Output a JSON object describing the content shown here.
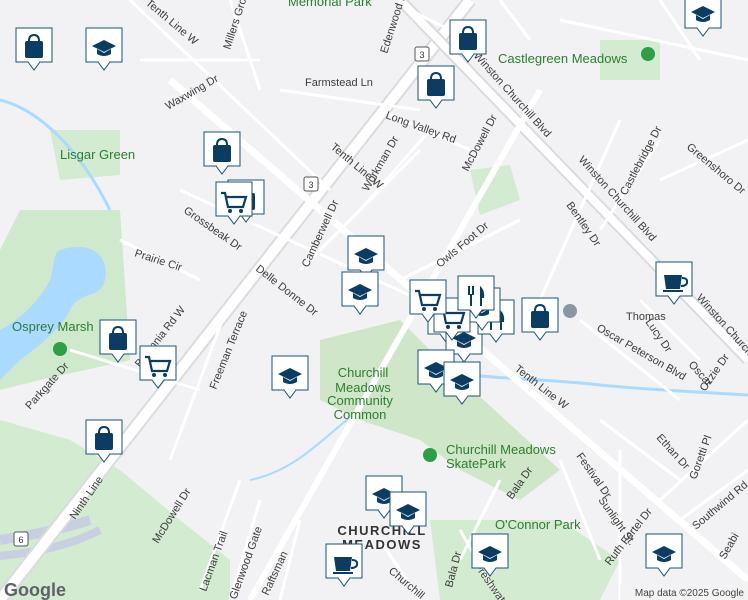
{
  "map": {
    "attribution": "Map data ©2025 Google",
    "logo": "Google",
    "colors": {
      "land": "#f2f2f4",
      "park": "#d3ebd0",
      "water": "#aadaff",
      "road": "#ffffff",
      "arterial": "#d9dbde",
      "pin_fill": "#ffffff",
      "pin_border": "#1a5276",
      "icon": "#0b3d63",
      "park_label": "#2e7d32"
    }
  },
  "places": {
    "memorial_park": "Memorial Park",
    "castlegreen_meadows": "Castlegreen Meadows",
    "lisgar_green": "Lisgar Green",
    "osprey_marsh": "Osprey Marsh",
    "community_common": [
      "Churchill",
      "Meadows",
      "Community",
      "Common"
    ],
    "skatepark": [
      "Churchill Meadows",
      "SkatePark"
    ],
    "oconnor_park": "O'Connor Park",
    "neighbourhood": [
      "CHURCHILL",
      "MEADOWS"
    ]
  },
  "streets": {
    "tenth_line_w_top": "Tenth Line W",
    "millers_grove": "Millers Grove",
    "edenwood_dr": "Edenwood Dr",
    "road_3": "3",
    "farmstead_ln": "Farmstead Ln",
    "waxwing_dr": "Waxwing Dr",
    "long_valley_rd": "Long Valley Rd",
    "mcdowell_dr_ne": "McDowell Dr",
    "winston_churchill_blvd_top": "Winston Churchill Blvd",
    "castlebridge_dr": "Castlebridge Dr",
    "greenshoro_dr": "Greenshoro Dr",
    "workman_dr": "Workman Dr",
    "tenth_line_w_mid": "Tenth Line W",
    "camberwell_dr": "Camberwell Dr",
    "grossbeak_dr": "Grossbeak Dr",
    "prairie_cir": "Prairie Cir",
    "britannia_rd_w": "Britannia Rd W",
    "delle_donne_dr": "Delle Donne Dr",
    "owls_foot_dr": "Owls Foot Dr",
    "bentley_dr": "Bentley Dr",
    "winston_churchill_blvd_right": "Winston Churchill Blvd",
    "thomas": "Thomas",
    "lucy_dr": "Lucy Dr",
    "oscar_peterson_blvd": "Oscar Peterson Blvd",
    "ozzie_dr": "Ozzie Dr",
    "tenth_line_w_low": "Tenth Line W",
    "freeman_terrace": "Freeman Terrace",
    "parkgate_dr": "Parkgate Dr",
    "ethan_dr": "Ethan Dr",
    "goretti_pl": "Goretti Pl",
    "southwind_rd": "Southwind Rd",
    "festival_dr": "Festival Dr",
    "sunlight_st": "Sunlight St.",
    "ruth_fertel_dr": "Ruth Fertel Dr",
    "bala_dr": "Bala Dr",
    "bala_dr_2": "Bala Dr",
    "mcdowell_dr_sw": "McDowell Dr",
    "ninth_line": "Ninth Line",
    "lacman_trail": "Lacman Trail",
    "glenwood_gate": "Glenwood Gate",
    "raftsman": "Raftsman",
    "churchill_low": "Churchill",
    "freshwater": "Freshwater",
    "seabird": "Seabi",
    "road_6": "6",
    "oscar_short": "Oscar"
  },
  "markers": [
    {
      "id": "m1",
      "type": "shopping",
      "label": "shopping-bag-icon"
    },
    {
      "id": "m2",
      "type": "school",
      "label": "school-icon"
    },
    {
      "id": "m3",
      "type": "shopping",
      "label": "shopping-bag-icon"
    },
    {
      "id": "m4",
      "type": "shopping",
      "label": "shopping-bag-icon"
    },
    {
      "id": "m5",
      "type": "school",
      "label": "school-icon"
    },
    {
      "id": "m6",
      "type": "shopping",
      "label": "shopping-bag-icon"
    },
    {
      "id": "m7",
      "type": "shopping",
      "label": "shopping-bag-icon"
    },
    {
      "id": "m8",
      "type": "grocery",
      "label": "shopping-cart-icon"
    },
    {
      "id": "m9",
      "type": "school",
      "label": "school-icon"
    },
    {
      "id": "m10",
      "type": "school",
      "label": "school-icon"
    },
    {
      "id": "m11",
      "type": "grocery",
      "label": "shopping-cart-icon"
    },
    {
      "id": "m12",
      "type": "restaurant",
      "label": "restaurant-icon"
    },
    {
      "id": "m13",
      "type": "cafe",
      "label": "coffee-cup-icon"
    },
    {
      "id": "m14",
      "type": "shopping",
      "label": "shopping-bag-icon"
    },
    {
      "id": "m15",
      "type": "grocery",
      "label": "shopping-cart-icon"
    },
    {
      "id": "m16",
      "type": "shopping",
      "label": "shopping-bag-icon"
    },
    {
      "id": "m17",
      "type": "school",
      "label": "school-icon"
    },
    {
      "id": "m18",
      "type": "school",
      "label": "school-icon"
    },
    {
      "id": "m19",
      "type": "school",
      "label": "school-icon"
    },
    {
      "id": "m20",
      "type": "shopping",
      "label": "shopping-bag-icon"
    },
    {
      "id": "m21",
      "type": "school",
      "label": "school-icon"
    },
    {
      "id": "m22",
      "type": "school",
      "label": "school-icon"
    },
    {
      "id": "m23",
      "type": "cafe",
      "label": "coffee-cup-icon"
    },
    {
      "id": "m24",
      "type": "school",
      "label": "school-icon"
    },
    {
      "id": "m25",
      "type": "school",
      "label": "school-icon"
    }
  ]
}
